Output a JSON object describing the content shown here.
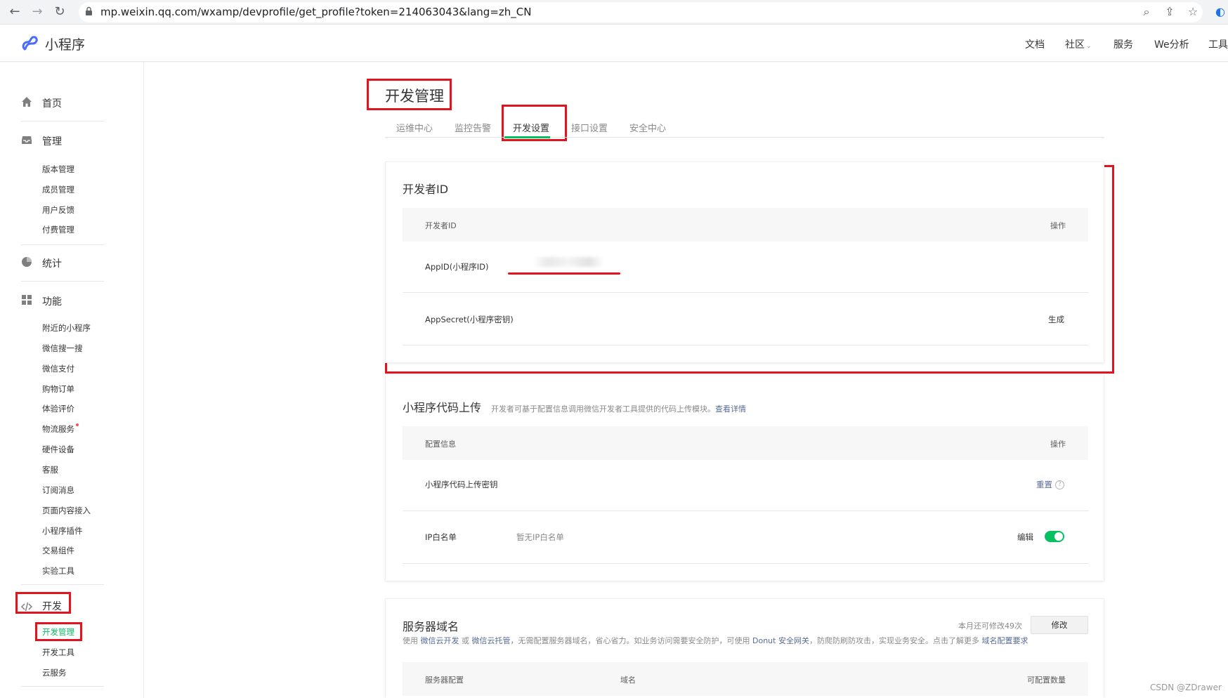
{
  "browser": {
    "url": "mp.weixin.qq.com/wxamp/devprofile/get_profile?token=214063043&lang=zh_CN"
  },
  "topnav": {
    "logo": "小程序",
    "links": [
      "文档",
      "社区",
      "服务",
      "We分析",
      "工具"
    ]
  },
  "sidebar": {
    "home": "首页",
    "manage": {
      "title": "管理",
      "items": [
        "版本管理",
        "成员管理",
        "用户反馈",
        "付费管理"
      ]
    },
    "stats": "统计",
    "features": {
      "title": "功能",
      "items": [
        "附近的小程序",
        "微信搜一搜",
        "微信支付",
        "购物订单",
        "体验评价",
        "物流服务",
        "硬件设备",
        "客服",
        "订阅消息",
        "页面内容接入",
        "小程序插件",
        "交易组件",
        "实验工具"
      ]
    },
    "dev": {
      "title": "开发",
      "items": [
        "开发管理",
        "开发工具",
        "云服务"
      ]
    }
  },
  "main": {
    "page_title": "开发管理",
    "tabs": [
      "运维中心",
      "监控告警",
      "开发设置",
      "接口设置",
      "安全中心"
    ],
    "active_tab": "开发设置",
    "dev_id": {
      "title": "开发者ID",
      "col_id": "开发者ID",
      "col_action": "操作",
      "appid_label": "AppID(小程序ID)",
      "appsecret_label": "AppSecret(小程序密钥)",
      "generate": "生成"
    },
    "upload": {
      "title": "小程序代码上传",
      "desc": "开发者可基于配置信息调用微信开发者工具提供的代码上传模块。",
      "desc_link": "查看详情",
      "col_config": "配置信息",
      "col_action": "操作",
      "key_label": "小程序代码上传密钥",
      "reset": "重置",
      "ip_label": "IP白名单",
      "ip_value": "暂无IP白名单",
      "edit": "编辑",
      "ip_toggle_on": true
    },
    "server": {
      "title": "服务器域名",
      "remaining": "本月还可修改49次",
      "modify": "修改",
      "desc_1": "使用",
      "link_1": "微信云开发",
      "desc_2": "或",
      "link_2": "微信云托管",
      "desc_3": "，无需配置服务器域名，省心省力。如业务访问需要安全防护，可使用",
      "link_3": "Donut 安全网关",
      "desc_4": "，防爬防刷防攻击，实现业务安全。点击了解更多",
      "link_4": "域名配置要求",
      "col_config": "服务器配置",
      "col_domain": "域名",
      "col_count": "可配置数量"
    }
  },
  "watermark": "CSDN @ZDrawer",
  "colors": {
    "accent": "#07c160",
    "link": "#576b95",
    "highlight": "#e0141e"
  }
}
